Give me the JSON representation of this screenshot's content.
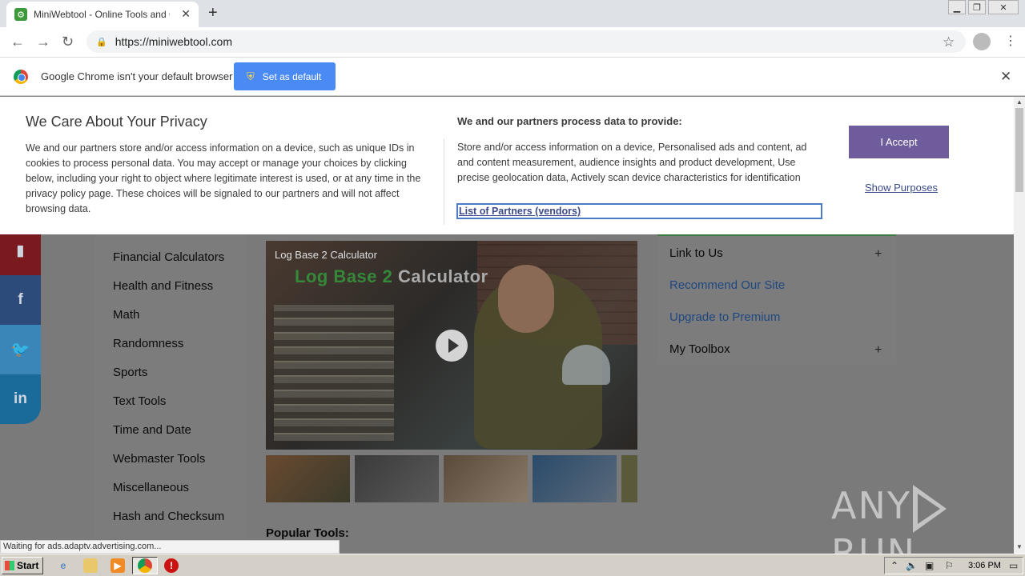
{
  "browser": {
    "tab_title": "MiniWebtool - Online Tools and Calcu",
    "url": "https://miniwebtool.com",
    "new_tab_symbol": "+",
    "tab_close_symbol": "✕"
  },
  "infobar": {
    "message": "Google Chrome isn't your default browser",
    "button_label": "Set as default"
  },
  "privacy": {
    "title": "We Care About Your Privacy",
    "body": "We and our partners store and/or access information on a device, such as unique IDs in cookies to process personal data. You may accept or manage your choices by clicking below, including your right to object where legitimate interest is used, or at any time in the privacy policy page. These choices will be signaled to our partners and will not affect browsing data.",
    "right_title": "We and our partners process data to provide:",
    "right_body": "Store and/or access information on a device, Personalised ads and content, ad and content measurement, audience insights and product development, Use precise geolocation data, Actively scan device characteristics for identification",
    "partners_link": "List of Partners (vendors)",
    "accept_label": "I Accept",
    "purposes_link": "Show Purposes"
  },
  "categories": [
    "Financial Calculators",
    "Health and Fitness",
    "Math",
    "Randomness",
    "Sports",
    "Text Tools",
    "Time and Date",
    "Webmaster Tools",
    "Miscellaneous",
    "Hash and Checksum"
  ],
  "video": {
    "title": "Log Base 2 Calculator",
    "overlay_text_1": "Log Base 2",
    "overlay_text_2": "Calculator"
  },
  "side_menu": {
    "link_to_us": "Link to Us",
    "recommend": "Recommend Our Site",
    "upgrade": "Upgrade to Premium",
    "my_toolbox": "My Toolbox",
    "expand_symbol": "+"
  },
  "popular_tools_heading": "Popular Tools:",
  "status_text": "Waiting for ads.adaptv.advertising.com...",
  "watermark": {
    "left": "ANY",
    "right": "RUN"
  },
  "taskbar": {
    "start_label": "Start",
    "clock": "3:06 PM"
  },
  "colors": {
    "accept_button": "#6f5c9c",
    "set_default_button": "#4a8af4",
    "link_blue": "#1f4780",
    "social_bookmark": "#b81d24",
    "social_facebook": "#2c4a7a",
    "social_twitter": "#3a86b8",
    "social_linkedin": "#1a6a9a"
  },
  "icons": {
    "favicon": "gear-icon",
    "bookmark": "bookmark-icon",
    "facebook": "facebook-icon",
    "twitter": "twitter-icon",
    "linkedin": "linkedin-icon",
    "play": "play-icon"
  }
}
